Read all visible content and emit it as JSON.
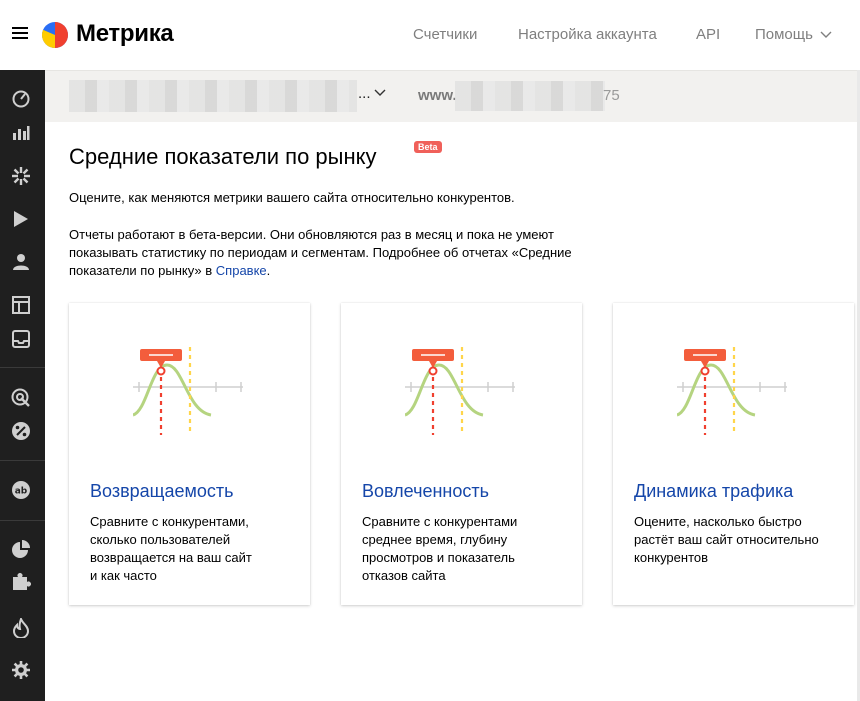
{
  "app": {
    "logo_text": "Метрика",
    "colors": {
      "accent_blue": "#1546a9",
      "beta_red": "#f0605a",
      "sidebar_bg": "#1f1f1f"
    }
  },
  "header": {
    "nav": [
      {
        "label": "Счетчики"
      },
      {
        "label": "Настройка аккаунта"
      },
      {
        "label": "API"
      },
      {
        "label": "Помощь"
      }
    ]
  },
  "sidebar": {
    "icons": [
      "dashboard-icon",
      "reports-icon",
      "goals-icon",
      "webvisor-icon",
      "audience-icon",
      "maps-icon",
      "inbox-icon",
      "target-icon",
      "percent-icon",
      "ab-test-icon",
      "pie-chart-icon",
      "puzzle-icon",
      "fire-icon",
      "settings-icon"
    ]
  },
  "counter_bar": {
    "counter_dots": "...",
    "site_prefix": "www.",
    "site_suffix": "75"
  },
  "main": {
    "title": "Средние показатели по рынку",
    "beta_badge": "Beta",
    "description": "Оцените, как меняются метрики вашего сайта относительно конкурентов.",
    "beta_note": "Отчеты работают в бета-версии. Они обновляются раз в месяц и пока не умеют показывать статистику по периодам и сегментам. Подробнее об отчетах «Средние показатели по рынку» в ",
    "help_link": "Справке",
    "beta_note_end": "."
  },
  "cards": [
    {
      "title": "Возвращаемость",
      "text": "Сравните с конкурентами,\nсколько пользователей\nвозвращается на ваш сайт\nи как часто"
    },
    {
      "title": "Вовлеченность",
      "text": "Сравните с конкурентами\nсреднее время, глубину\nпросмотров и показатель\nотказов сайта"
    },
    {
      "title": "Динамика трафика",
      "text": "Оцените, насколько быстро\nрастёт ваш сайт относительно\nконкурентов"
    }
  ]
}
